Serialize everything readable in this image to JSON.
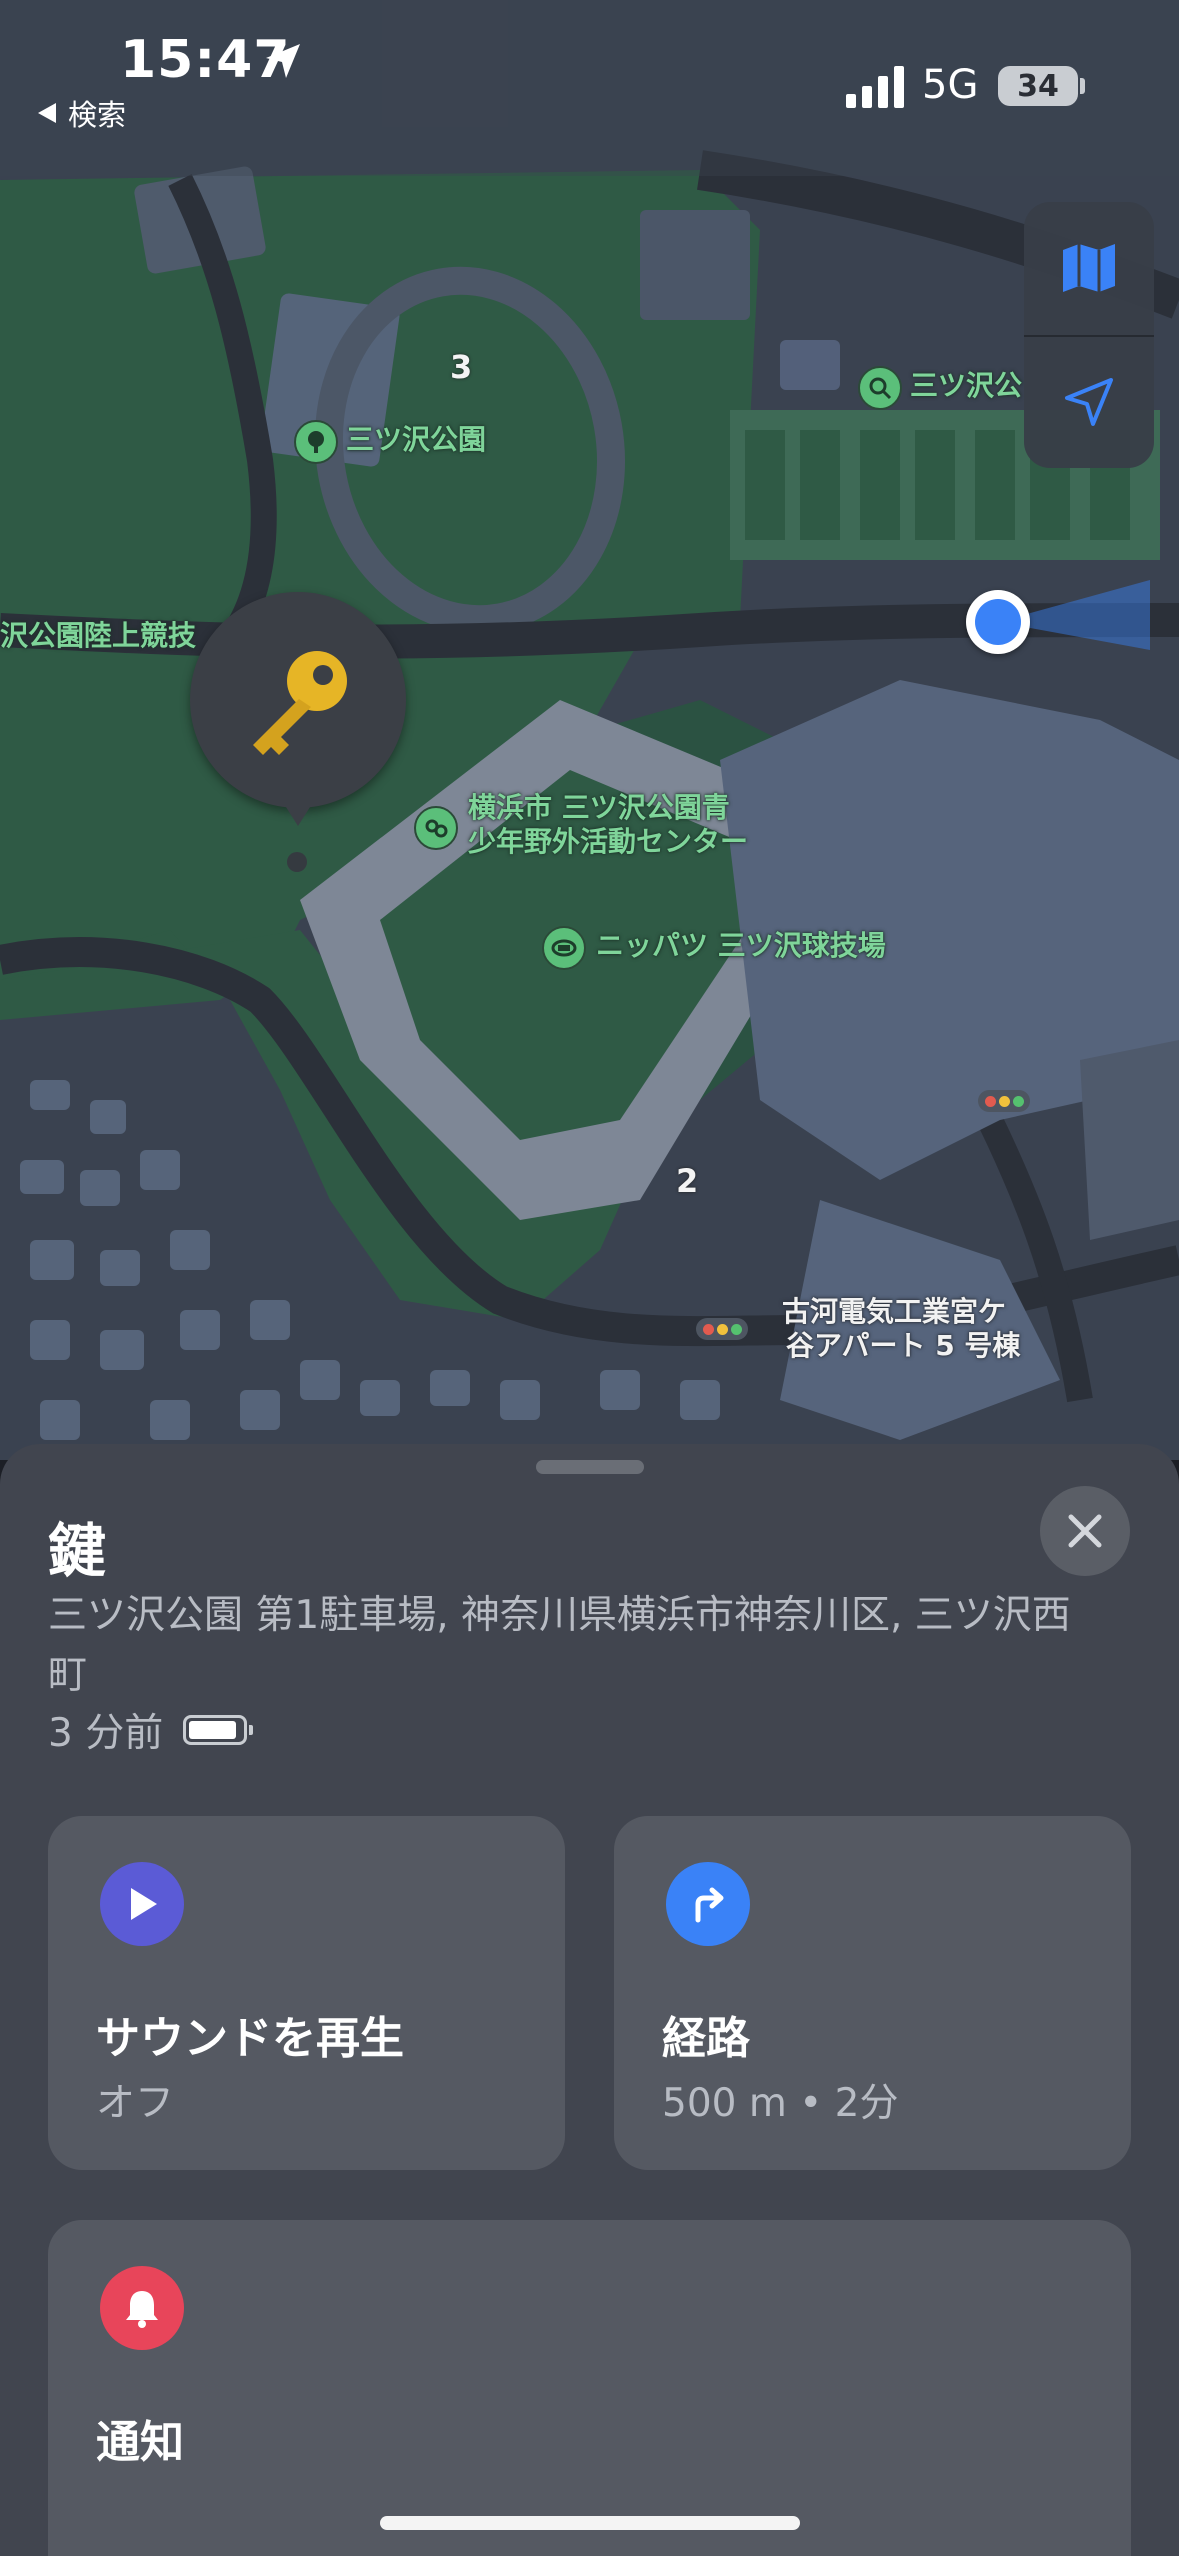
{
  "status_bar": {
    "time": "15:47",
    "back_label": "検索",
    "network": "5G",
    "battery": "34"
  },
  "map": {
    "labels": {
      "park": "三ツ沢公園",
      "track_field": "沢公園陸上競技",
      "youth_center_1": "横浜市 三ツ沢公園青",
      "youth_center_2": "少年野外活動センター",
      "stadium": "ニッパツ 三ツ沢球技場",
      "tennis": "三ツ沢公",
      "apartment_1": "古河電気工業宮ケ",
      "apartment_2": "谷アパート 5 号棟",
      "route_3": "3",
      "route_2": "2"
    },
    "controls": {
      "map_mode_icon": "map-icon",
      "locate_icon": "location-arrow-icon"
    },
    "pin_icon": "key-icon"
  },
  "sheet": {
    "title": "鍵",
    "address": "三ツ沢公園 第1駐車場, 神奈川県横浜市神奈川区, 三ツ沢西町",
    "time_ago": "3 分前",
    "actions": {
      "sound": {
        "title": "サウンドを再生",
        "subtitle": "オフ",
        "color": "#5b5bd6"
      },
      "route": {
        "title": "経路",
        "subtitle": "500 m • 2分",
        "color": "#3a82f7"
      },
      "notify": {
        "title": "通知",
        "color": "#e8455a"
      }
    }
  }
}
